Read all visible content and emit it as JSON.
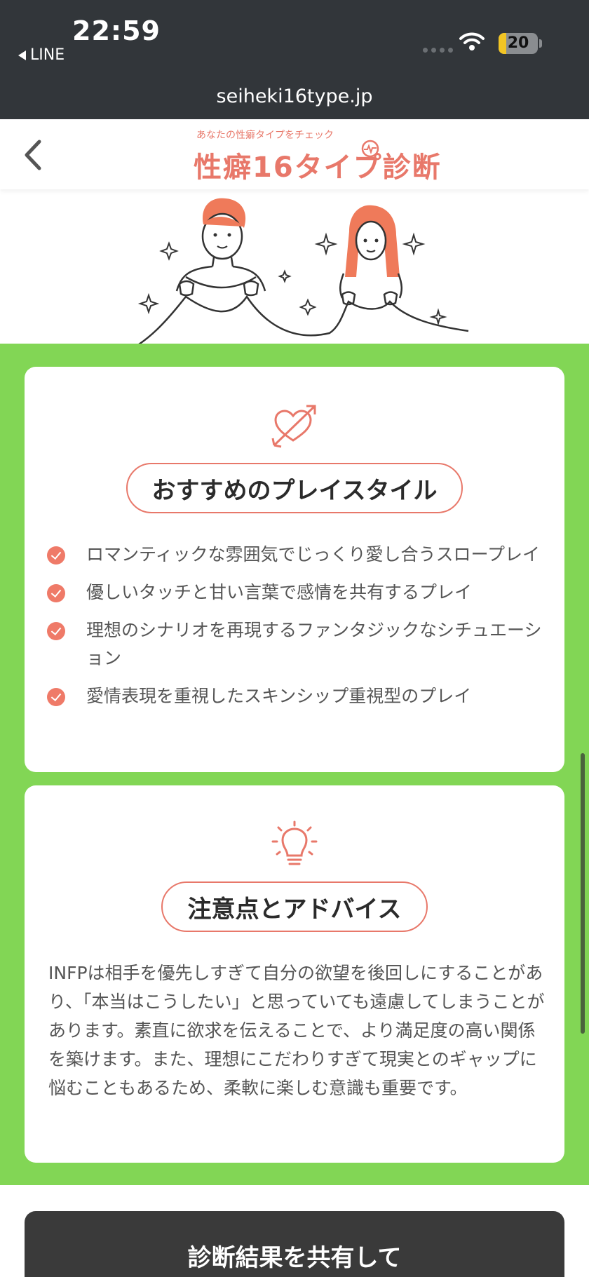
{
  "status_bar": {
    "time": "22:59",
    "back_app": "LINE",
    "battery_level": "20",
    "battery_fraction": 0.2
  },
  "browser": {
    "url": "seiheki16type.jp"
  },
  "site_header": {
    "logo_tagline": "あなたの性癖タイプをチェック",
    "logo_title": "性癖16タイプ診断",
    "back_icon": "chevron-left-icon"
  },
  "colors": {
    "accent_coral": "#e8786a",
    "background_green": "#82d655",
    "dark_bar": "#32363a"
  },
  "play_style": {
    "icon": "heart-arrow-icon",
    "heading": "おすすめのプレイスタイル",
    "items": [
      "ロマンティックな雰囲気でじっくり愛し合うスロープレイ",
      "優しいタッチと甘い言葉で感情を共有するプレイ",
      "理想のシナリオを再現するファンタジックなシチュエーション",
      "愛情表現を重視したスキンシップ重視型のプレイ"
    ]
  },
  "advice": {
    "icon": "lightbulb-icon",
    "heading": "注意点とアドバイス",
    "body": "INFPは相手を優先しすぎて自分の欲望を後回しにすることがあり、「本当はこうしたい」と思っていても遠慮してしまうことがあります。素直に欲求を伝えることで、より満足度の高い関係を築けます。また、理想にこだわりすぎて現実とのギャップに悩むこともあるため、柔軟に楽しむ意識も重要です。"
  },
  "share": {
    "label": "診断結果を共有して"
  }
}
